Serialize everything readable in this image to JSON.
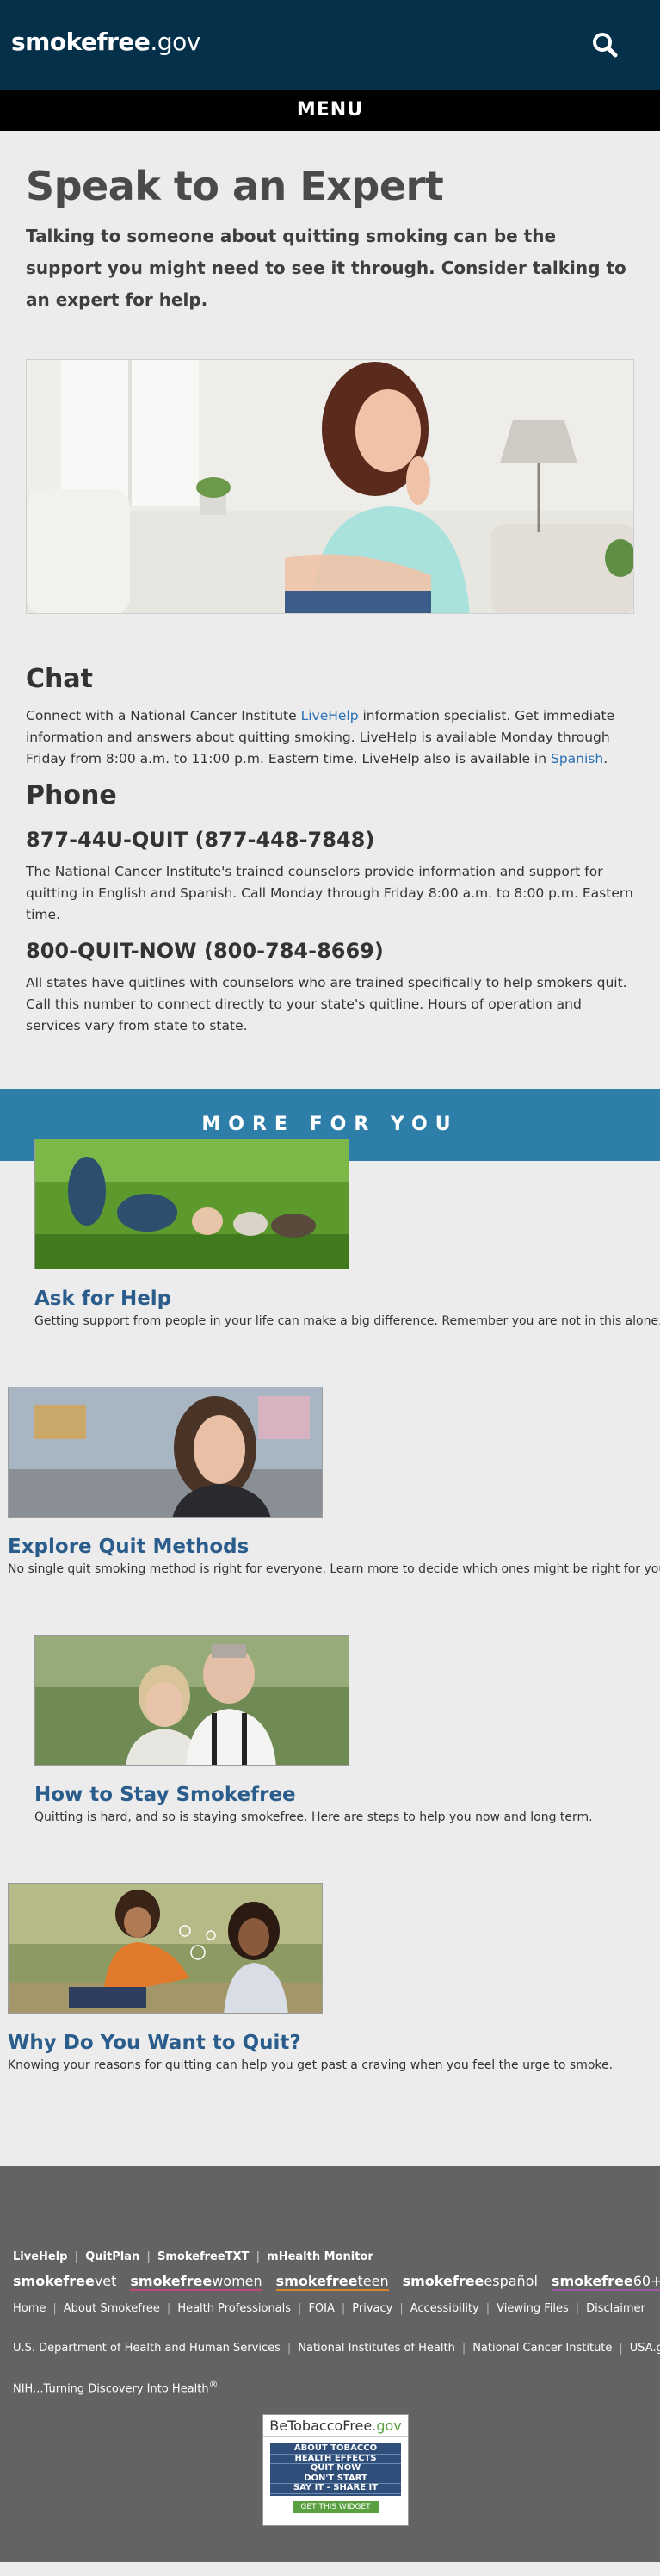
{
  "header": {
    "logo_bold": "smokefree",
    "logo_rest": ".gov",
    "search_icon": "search-icon",
    "menu_label": "MENU"
  },
  "page": {
    "title": "Speak to an Expert",
    "lead": "Talking to someone about quitting smoking can be the support you might need to see it through. Consider talking to an expert for help."
  },
  "chat": {
    "heading": "Chat",
    "text_1": "Connect with a National Cancer Institute ",
    "link_livehelp": "LiveHelp",
    "text_2": " information specialist. Get immediate information and answers about quitting smoking. LiveHelp is available Monday through Friday from 8:00 a.m. to 11:00 p.m. Eastern time. LiveHelp also is available in ",
    "link_spanish": "Spanish",
    "text_3": "."
  },
  "phone": {
    "heading": "Phone",
    "number_1": "877-44U-QUIT (877-448-7848)",
    "text_1": "The National Cancer Institute's trained counselors provide information and support for quitting in English and Spanish. Call Monday through Friday 8:00 a.m. to 8:00 p.m. Eastern time.",
    "number_2": "800-QUIT-NOW (800-784-8669)",
    "text_2": "All states have quitlines with counselors who are trained specifically to help smokers quit. Call this number to connect directly to your state's quitline. Hours of operation and services vary from state to state."
  },
  "more": {
    "heading": "MORE FOR YOU",
    "cards": [
      {
        "title": "Ask for Help",
        "desc": "Getting support from people in your life can make a big difference. Remember you are not in this alone."
      },
      {
        "title": "Explore Quit Methods",
        "desc": "No single quit smoking method is right for everyone. Learn more to decide which ones might be right for you."
      },
      {
        "title": "How to Stay Smokefree",
        "desc": "Quitting is hard, and so is staying smokefree. Here are steps to help you now and long term."
      },
      {
        "title": "Why Do You Want to Quit?",
        "desc": "Knowing your reasons for quitting can help you get past a craving when you feel the urge to smoke."
      }
    ]
  },
  "footer": {
    "tools": [
      "LiveHelp",
      "QuitPlan",
      "SmokefreeTXT",
      "mHealth Monitor"
    ],
    "brands": [
      {
        "bold": "smokefree",
        "rest": "vet"
      },
      {
        "bold": "smokefree",
        "rest": "women"
      },
      {
        "bold": "smokefree",
        "rest": "teen"
      },
      {
        "bold": "smokefree",
        "rest": "español"
      },
      {
        "bold": "smokefree",
        "rest": "60+"
      }
    ],
    "links": [
      "Home",
      "About Smokefree",
      "Health Professionals",
      "FOIA",
      "Privacy",
      "Accessibility",
      "Viewing Files",
      "Disclaimer"
    ],
    "agencies": [
      "U.S. Department of Health and Human Services",
      "National Institutes of Health",
      "National Cancer Institute",
      "USA.gov"
    ],
    "tagline": "NIH...Turning Discovery Into Health",
    "tagline_mark": "®",
    "widget": {
      "title_1": "BeTobaccoFree",
      "title_2": ".gov",
      "items": [
        "ABOUT TOBACCO",
        "HEALTH EFFECTS",
        "QUIT NOW",
        "DON'T START",
        "SAY IT - SHARE IT"
      ],
      "button": "GET THIS WIDGET"
    }
  }
}
